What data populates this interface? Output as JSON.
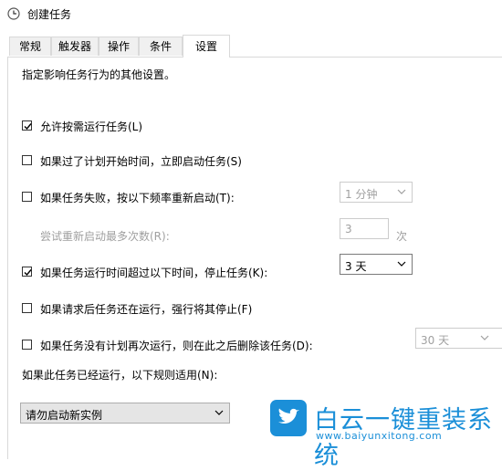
{
  "window": {
    "title": "创建任务",
    "icon": "clock-icon"
  },
  "tabs": [
    {
      "label": "常规",
      "active": false
    },
    {
      "label": "触发器",
      "active": false
    },
    {
      "label": "操作",
      "active": false
    },
    {
      "label": "条件",
      "active": false
    },
    {
      "label": "设置",
      "active": true
    }
  ],
  "settings": {
    "description": "指定影响任务行为的其他设置。",
    "allow_on_demand": {
      "label": "允许按需运行任务(L)",
      "checked": true
    },
    "run_asap": {
      "label": "如果过了计划开始时间，立即启动任务(S)",
      "checked": false
    },
    "restart_on_fail": {
      "label": "如果任务失败，按以下频率重新启动(T):",
      "checked": false,
      "interval_value": "1 分钟"
    },
    "restart_attempts": {
      "label": "尝试重新启动最多次数(R):",
      "value": "3",
      "unit": "次"
    },
    "stop_if_longer": {
      "label": "如果任务运行时间超过以下时间，停止任务(K):",
      "checked": true,
      "duration_value": "3 天"
    },
    "force_stop": {
      "label": "如果请求后任务还在运行，强行将其停止(F)",
      "checked": false
    },
    "delete_if_not_scheduled": {
      "label": "如果任务没有计划再次运行，则在此之后删除该任务(D):",
      "checked": false,
      "after_value": "30 天"
    },
    "rule_label": "如果此任务已经运行，以下规则适用(N):",
    "rule_value": "请勿启动新实例"
  },
  "watermark": {
    "text": "白云一键重装系统",
    "url": "www.baiyunxitong.com",
    "color": "#1b8fd8"
  }
}
